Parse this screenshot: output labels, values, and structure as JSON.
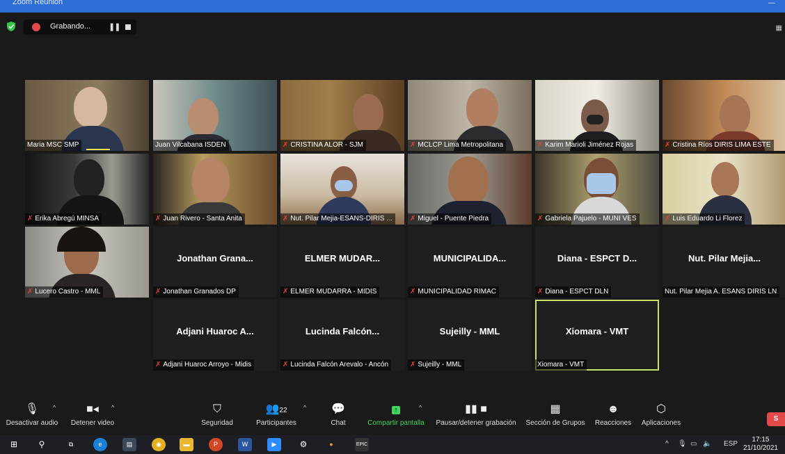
{
  "window": {
    "title": "Zoom Reunión"
  },
  "recording": {
    "status": "Grabando..."
  },
  "participants": [
    {
      "label": "Maria MSC SMP",
      "muted": false
    },
    {
      "label": "Juan Vilcabana ISDEN",
      "muted": false
    },
    {
      "label": "CRISTINA ALOR - SJM",
      "muted": true
    },
    {
      "label": "MCLCP Lima Metropolitana",
      "muted": true
    },
    {
      "label": "Karim Marioli Jiménez Rojas",
      "muted": true
    },
    {
      "label": "Cristina Ríos DIRIS LIMA ESTE",
      "muted": true
    },
    {
      "label": "Erika Abregú MINSA",
      "muted": true
    },
    {
      "label": "Juan Rivero - Santa Anita",
      "muted": true
    },
    {
      "label": "Nut. Pilar Mejia-ESANS-DIRIS ...",
      "muted": true
    },
    {
      "label": "Miguel - Puente Piedra",
      "muted": true
    },
    {
      "label": "Gabriela Pajuelo - MUNI VES",
      "muted": true
    },
    {
      "label": "Luis Eduardo Li Florez",
      "muted": true
    },
    {
      "label": "Lucero Castro - MML",
      "muted": true
    },
    {
      "label": "Jonathan Granados DP",
      "muted": true,
      "display": "Jonathan Grana..."
    },
    {
      "label": "ELMER MUDARRA - MIDIS",
      "muted": true,
      "display": "ELMER MUDAR..."
    },
    {
      "label": "MUNICIPALIDAD RIMAC",
      "muted": true,
      "display": "MUNICIPALIDA..."
    },
    {
      "label": "Diana - ESPCT DLN",
      "muted": true,
      "display": "Diana - ESPCT D..."
    },
    {
      "label": "Nut. Pilar Mejia A. ESANS DIRIS LN",
      "muted": false,
      "display": "Nut. Pilar Mejia..."
    },
    {
      "label": "Adjani Huaroc Arroyo - Midis",
      "muted": true,
      "display": "Adjani Huaroc A..."
    },
    {
      "label": "Lucinda Falcón Arevalo - Ancón",
      "muted": true,
      "display": "Lucinda Falcón..."
    },
    {
      "label": "Sujeilly - MML",
      "muted": true,
      "display": "Sujeilly - MML"
    },
    {
      "label": "Xiomara - VMT",
      "muted": false,
      "display": "Xiomara - VMT"
    }
  ],
  "toolbar": {
    "mute": "Desactivar audio",
    "video": "Detener video",
    "security": "Seguridad",
    "participants": "Participantes",
    "participants_count": "22",
    "chat": "Chat",
    "share": "Compartir pantalla",
    "record": "Pausar/detener grabación",
    "breakout": "Sección de Grupos",
    "reactions": "Reacciones",
    "apps": "Aplicaciones",
    "end": "S"
  },
  "taskbar": {
    "lang": "ESP",
    "time": "17:15",
    "date": "21/10/2021"
  },
  "colors": {
    "accent_green": "#3fd65b",
    "active_speaker": "#c7e06b",
    "title_bar": "#2d6fd6"
  }
}
